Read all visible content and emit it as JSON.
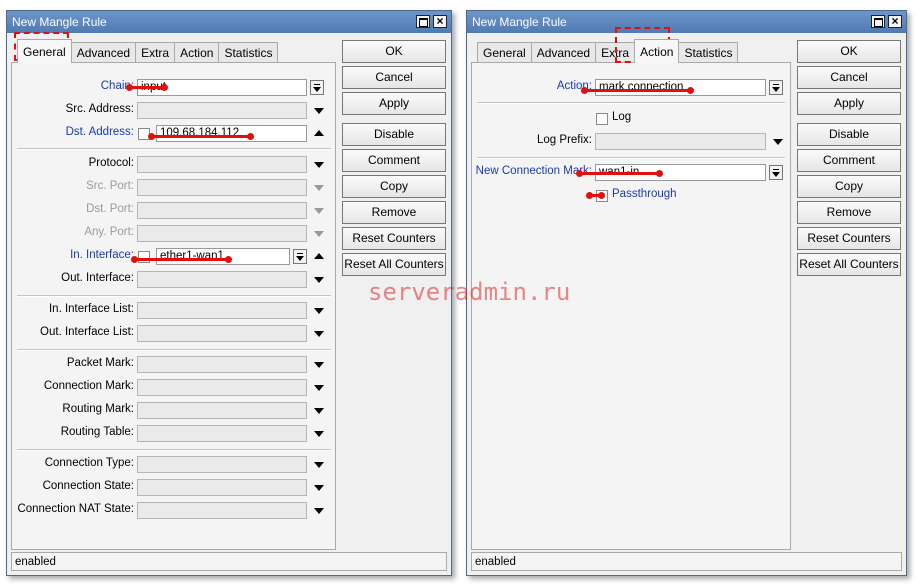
{
  "left": {
    "title": "New Mangle Rule",
    "tabs": [
      "General",
      "Advanced",
      "Extra",
      "Action",
      "Statistics"
    ],
    "chain_label": "Chain:",
    "chain_value": "input",
    "src_address_label": "Src. Address:",
    "dst_address_label": "Dst. Address:",
    "dst_address_value": "109.68.184.112",
    "protocol_label": "Protocol:",
    "src_port_label": "Src. Port:",
    "dst_port_label": "Dst. Port:",
    "any_port_label": "Any. Port:",
    "in_interface_label": "In. Interface:",
    "in_interface_value": "ether1-wan1",
    "out_interface_label": "Out. Interface:",
    "in_interface_list_label": "In. Interface List:",
    "out_interface_list_label": "Out. Interface List:",
    "packet_mark_label": "Packet Mark:",
    "connection_mark_label": "Connection Mark:",
    "routing_mark_label": "Routing Mark:",
    "routing_table_label": "Routing Table:",
    "connection_type_label": "Connection Type:",
    "connection_state_label": "Connection State:",
    "connection_nat_state_label": "Connection NAT State:",
    "status": "enabled"
  },
  "right": {
    "title": "New Mangle Rule",
    "tabs": [
      "General",
      "Advanced",
      "Extra",
      "Action",
      "Statistics"
    ],
    "action_label": "Action:",
    "action_value": "mark connection",
    "log_label": "Log",
    "log_prefix_label": "Log Prefix:",
    "new_conn_mark_label": "New Connection Mark:",
    "new_conn_mark_value": "wan1-in",
    "passthrough_label": "Passthrough",
    "status": "enabled"
  },
  "buttons": [
    "OK",
    "Cancel",
    "Apply",
    "Disable",
    "Comment",
    "Copy",
    "Remove",
    "Reset Counters",
    "Reset All Counters"
  ],
  "watermark": "serveradmin.ru",
  "colors": {
    "title_bar": "#5a86bd",
    "annotation": "#e01010",
    "link_label": "#1a3ab0"
  }
}
